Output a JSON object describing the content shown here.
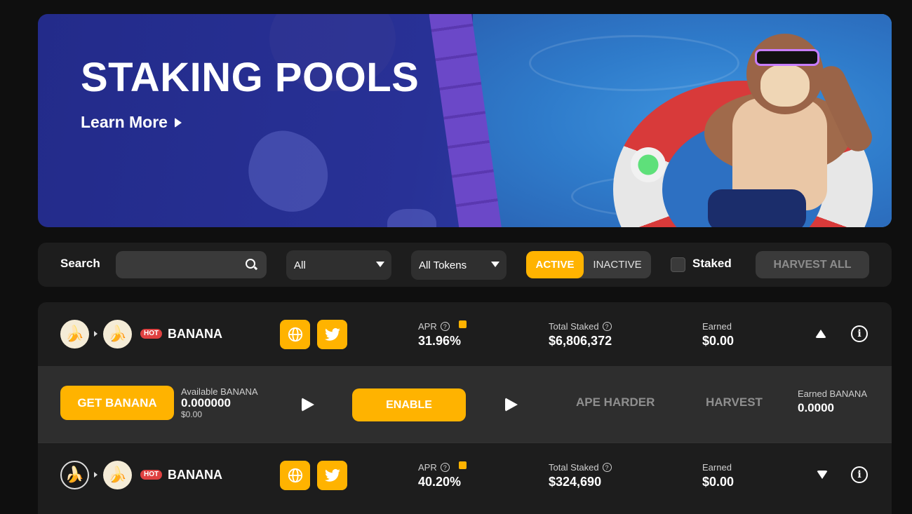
{
  "banner": {
    "title": "STAKING POOLS",
    "learn_more": "Learn More"
  },
  "filters": {
    "search_label": "Search",
    "search_value": "",
    "category_select": "All",
    "token_select": "All Tokens",
    "toggle_active": "ACTIVE",
    "toggle_inactive": "INACTIVE",
    "staked_label": "Staked",
    "harvest_all": "HARVEST ALL"
  },
  "pools": [
    {
      "badge": "HOT",
      "name": "BANANA",
      "apr_label": "APR",
      "apr": "31.96%",
      "total_staked_label": "Total Staked",
      "total_staked": "$6,806,372",
      "earned_label": "Earned",
      "earned": "$0.00",
      "expanded": true
    },
    {
      "badge": "HOT",
      "name": "BANANA",
      "apr_label": "APR",
      "apr": "40.20%",
      "total_staked_label": "Total Staked",
      "total_staked": "$324,690",
      "earned_label": "Earned",
      "earned": "$0.00",
      "expanded": false
    }
  ],
  "details": {
    "get_button": "GET BANANA",
    "available_label": "Available BANANA",
    "available_value": "0.000000",
    "available_usd": "$0.00",
    "enable_button": "ENABLE",
    "ape_harder": "APE HARDER",
    "harvest": "HARVEST",
    "earned_banana_label": "Earned BANANA",
    "earned_banana_value": "0.0000"
  },
  "colors": {
    "accent": "#ffb300",
    "hot": "#df4141",
    "panel": "#1d1d1d",
    "expanded": "#2e2e2e"
  },
  "icons": [
    "search-icon",
    "caret-down-icon",
    "globe-icon",
    "twitter-icon",
    "calculator-icon",
    "help-icon",
    "info-icon",
    "play-icon",
    "chevron-up-icon",
    "chevron-down-icon",
    "banana-token-icon"
  ]
}
